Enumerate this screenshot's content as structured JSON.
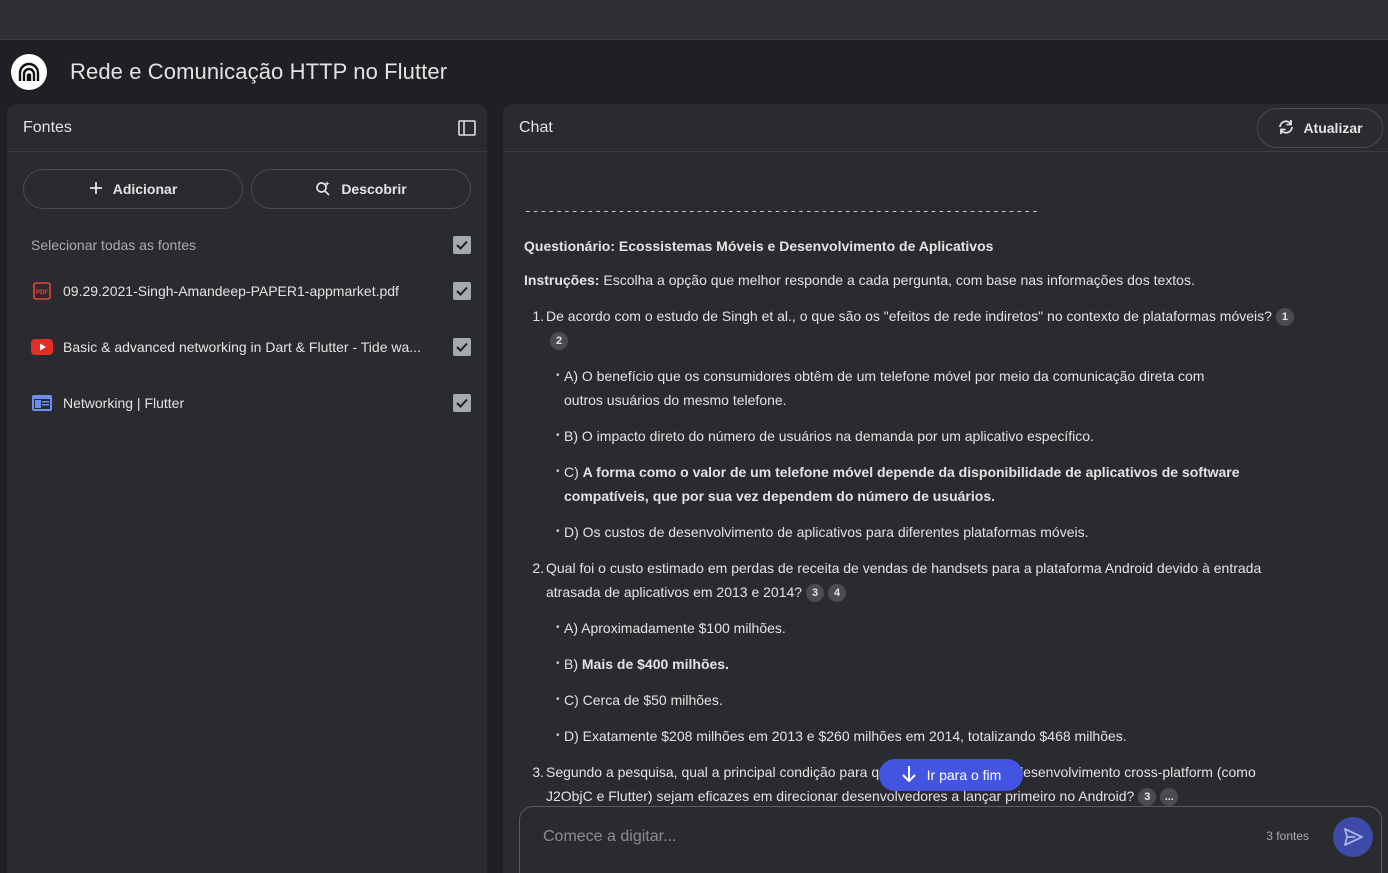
{
  "app": {
    "title": "Rede e Comunicação HTTP no Flutter"
  },
  "sources": {
    "header": "Fontes",
    "add_label": "Adicionar",
    "discover_label": "Descobrir",
    "select_all_label": "Selecionar todas as fontes",
    "items": [
      {
        "label": "09.29.2021-Singh-Amandeep-PAPER1-appmarket.pdf",
        "icon": "pdf-icon",
        "checked": true
      },
      {
        "label": "Basic & advanced networking in Dart & Flutter - Tide wa...",
        "icon": "youtube-icon",
        "checked": true
      },
      {
        "label": "Networking | Flutter",
        "icon": "web-icon",
        "checked": true
      }
    ]
  },
  "chat": {
    "header": "Chat",
    "refresh_label": "Atualizar",
    "separator": "---------------------------------------------------------------------------------",
    "quiz_title": "Questionário: Ecossistemas Móveis e Desenvolvimento de Aplicativos",
    "instructions_label": "Instruções:",
    "instructions_text": " Escolha a opção que melhor responde a cada pergunta, com base nas informações dos textos.",
    "questions": [
      {
        "num": "1.",
        "text": "De acordo com o estudo de Singh et al., o que são os \"efeitos de rede indiretos\" no contexto de plataformas móveis?",
        "cites": [
          "1",
          "2"
        ],
        "options": [
          {
            "text": "A) O benefício que os consumidores obtêm de um telefone móvel por meio da comunicação direta com outros usuários do mesmo telefone.",
            "bold": false
          },
          {
            "text": "B) O impacto direto do número de usuários na demanda por um aplicativo específico.",
            "bold": false
          },
          {
            "prefix": "C) ",
            "text": "A forma como o valor de um telefone móvel depende da disponibilidade de aplicativos de software compatíveis, que por sua vez dependem do número de usuários.",
            "bold": true
          },
          {
            "text": "D) Os custos de desenvolvimento de aplicativos para diferentes plataformas móveis.",
            "bold": false
          }
        ]
      },
      {
        "num": "2.",
        "text": "Qual foi o custo estimado em perdas de receita de vendas de handsets para a plataforma Android devido à entrada atrasada de aplicativos em 2013 e 2014?",
        "cites": [
          "3",
          "4"
        ],
        "options": [
          {
            "text": "A) Aproximadamente $100 milhões.",
            "bold": false
          },
          {
            "prefix": "B) ",
            "text": "Mais de $400 milhões.",
            "bold": true
          },
          {
            "text": "C) Cerca de $50 milhões.",
            "bold": false
          },
          {
            "text": "D) Exatamente $208 milhões em 2013 e $260 milhões em 2014, totalizando $468 milhões.",
            "bold": false
          }
        ]
      },
      {
        "num": "3.",
        "text": "Segundo a pesquisa, qual a principal condição para que as ferramentas de desenvolvimento cross-platform (como J2ObjC e Flutter) sejam eficazes em direcionar desenvolvedores a lançar primeiro no Android?",
        "cites": [
          "3",
          "..."
        ]
      }
    ],
    "jump_label": "Ir para o fim",
    "input_placeholder": "Comece a digitar...",
    "source_count": "3 fontes"
  },
  "colors": {
    "accent": "#4355e0",
    "background": "#1f2023",
    "panel": "#2a2b2f"
  }
}
